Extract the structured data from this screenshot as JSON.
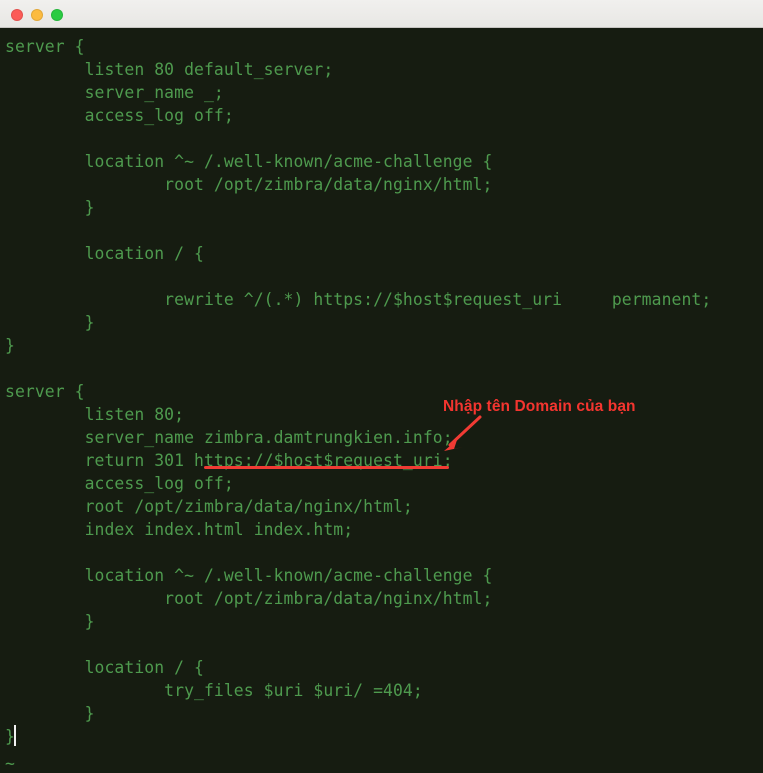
{
  "window": {
    "titlebar": {
      "buttons": [
        {
          "name": "close",
          "label": "Close",
          "color": "#fc5b57"
        },
        {
          "name": "minimize",
          "label": "Minimize",
          "color": "#fcbb40"
        },
        {
          "name": "maximize",
          "label": "Maximize",
          "color": "#2acb42"
        }
      ],
      "title": ""
    }
  },
  "terminal": {
    "background_color": "#161c11",
    "text_color": "#4e9a4e",
    "tilde_color": "#3b43c9",
    "cursor_color": "#f2f2f2",
    "content": "server {\n        listen 80 default_server;\n        server_name _;\n        access_log off;\n\n        location ^~ /.well-known/acme-challenge {\n                root /opt/zimbra/data/nginx/html;\n        }\n\n        location / {\n\n                rewrite ^/(.*) https://$host$request_uri     permanent;\n        }\n}\n\nserver {\n        listen 80;\n        server_name zimbra.damtrungkien.info;\n        return 301 https://$host$request_uri;\n        access_log off;\n        root /opt/zimbra/data/nginx/html;\n        index index.html index.htm;\n\n        location ^~ /.well-known/acme-challenge {\n                root /opt/zimbra/data/nginx/html;\n        }\n\n        location / {\n                try_files $uri $uri/ =404;\n        }\n}",
    "empty_line_marker": "~",
    "lines": [
      "server {",
      "        listen 80 default_server;",
      "        server_name _;",
      "        access_log off;",
      "",
      "        location ^~ /.well-known/acme-challenge {",
      "                root /opt/zimbra/data/nginx/html;",
      "        }",
      "",
      "        location / {",
      "",
      "                rewrite ^/(.*) https://$host$request_uri     permanent;",
      "        }",
      "}",
      "",
      "server {",
      "        listen 80;",
      "        server_name zimbra.damtrungkien.info;",
      "        return 301 https://$host$request_uri;",
      "        access_log off;",
      "        root /opt/zimbra/data/nginx/html;",
      "        index index.html index.htm;",
      "",
      "        location ^~ /.well-known/acme-challenge {",
      "                root /opt/zimbra/data/nginx/html;",
      "        }",
      "",
      "        location / {",
      "                try_files $uri $uri/ =404;",
      "        }",
      "}"
    ]
  },
  "annotation": {
    "note_text": "Nhập tên Domain của bạn",
    "highlighted_value": "zimbra.damtrungkien.info",
    "color": "#f4352f"
  }
}
